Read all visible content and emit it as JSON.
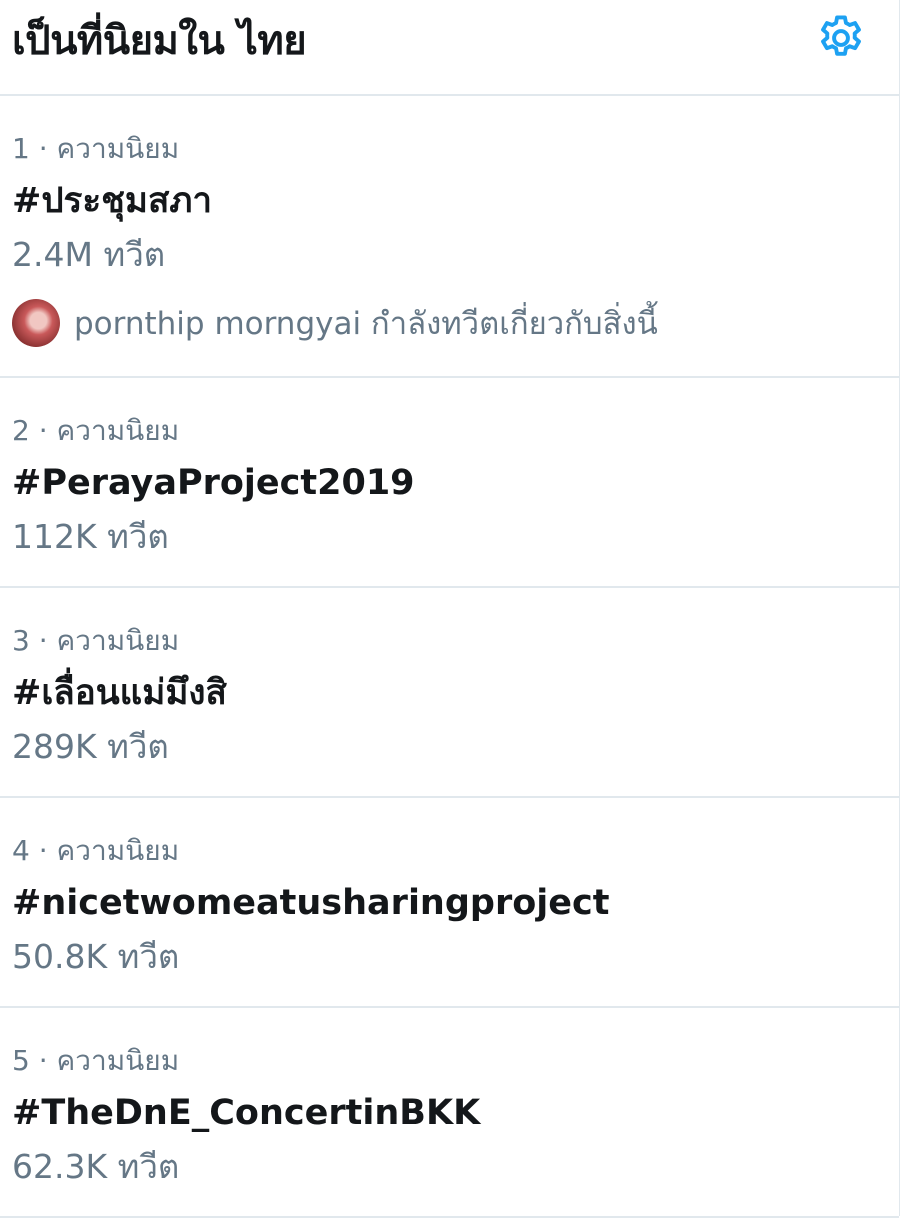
{
  "header": {
    "title": "เป็นที่นิยมใน ไทย",
    "settings_icon": "gear-icon",
    "accent_color": "#1da1f2"
  },
  "trends": [
    {
      "meta": "1 · ความนิยม",
      "name": "#ประชุมสภา",
      "count": "2.4M ทวีต",
      "context": {
        "avatar_icon": "avatar",
        "text": "pornthip morngyai กำลังทวีตเกี่ยวกับสิ่งนี้"
      }
    },
    {
      "meta": "2 · ความนิยม",
      "name": "#PerayaProject2019",
      "count": "112K ทวีต"
    },
    {
      "meta": "3 · ความนิยม",
      "name": "#เลื่อนแม่มึงสิ",
      "count": "289K ทวีต"
    },
    {
      "meta": "4 · ความนิยม",
      "name": "#nicetwomeatusharingproject",
      "count": "50.8K ทวีต"
    },
    {
      "meta": "5 · ความนิยม",
      "name": "#TheDnE_ConcertinBKK",
      "count": "62.3K ทวีต"
    }
  ]
}
